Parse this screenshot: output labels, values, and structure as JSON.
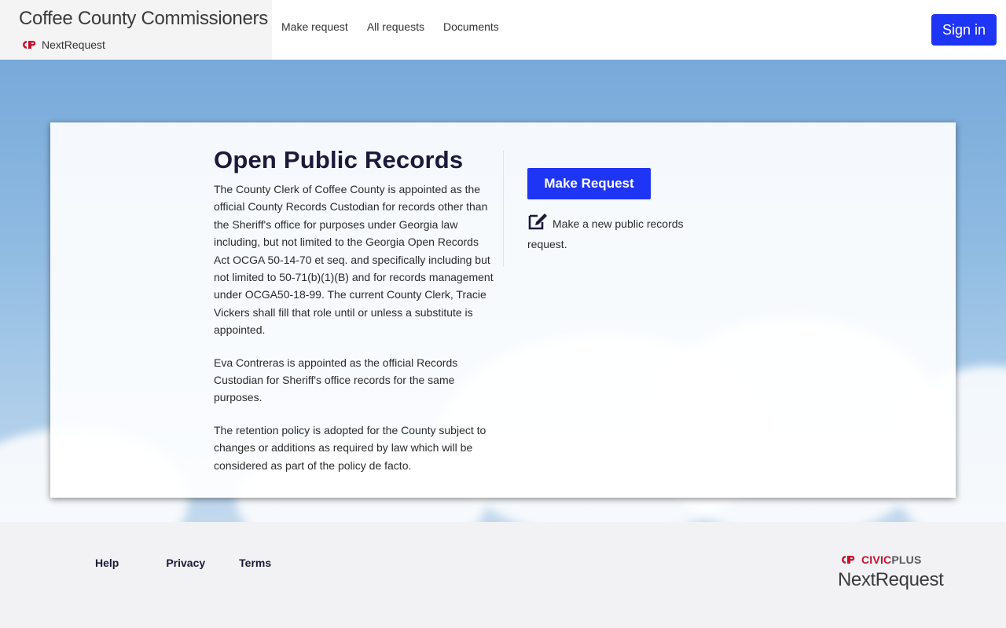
{
  "header": {
    "org_title": "Coffee County Commissioners",
    "product_name": "NextRequest",
    "nav": [
      {
        "label": "Make request"
      },
      {
        "label": "All requests"
      },
      {
        "label": "Documents"
      }
    ],
    "sign_in_label": "Sign in",
    "accent_color": "#1f35f5"
  },
  "main": {
    "title": "Open Public Records",
    "paragraphs": [
      "The County Clerk of Coffee County is appointed as the official County Records Custodian for records other than the Sheriff's office for purposes under Georgia law including, but not limited to the Georgia Open Records Act OCGA 50-14-70 et seq. and specifically including but not limited to 50-71(b)(1)(B) and for records management under OCGA50-18-99. The current County Clerk, Tracie Vickers shall fill that role until or unless a substitute is appointed.",
      "Eva Contreras is appointed as the official Records Custodian for Sheriff's office records for the same purposes.",
      "The retention policy is adopted for the County subject to changes or additions as required by law which will be considered as part of the policy de facto."
    ],
    "make_request_label": "Make Request",
    "make_request_desc": "Make a new public records request.",
    "make_request_icon": "edit-icon"
  },
  "footer": {
    "links": [
      {
        "label": "Help"
      },
      {
        "label": "Privacy"
      },
      {
        "label": "Terms"
      }
    ],
    "civic_brand_a": "CIVIC",
    "civic_brand_b": "PLUS",
    "nextrequest": "NextRequest",
    "brand_red": "#c8102e"
  }
}
